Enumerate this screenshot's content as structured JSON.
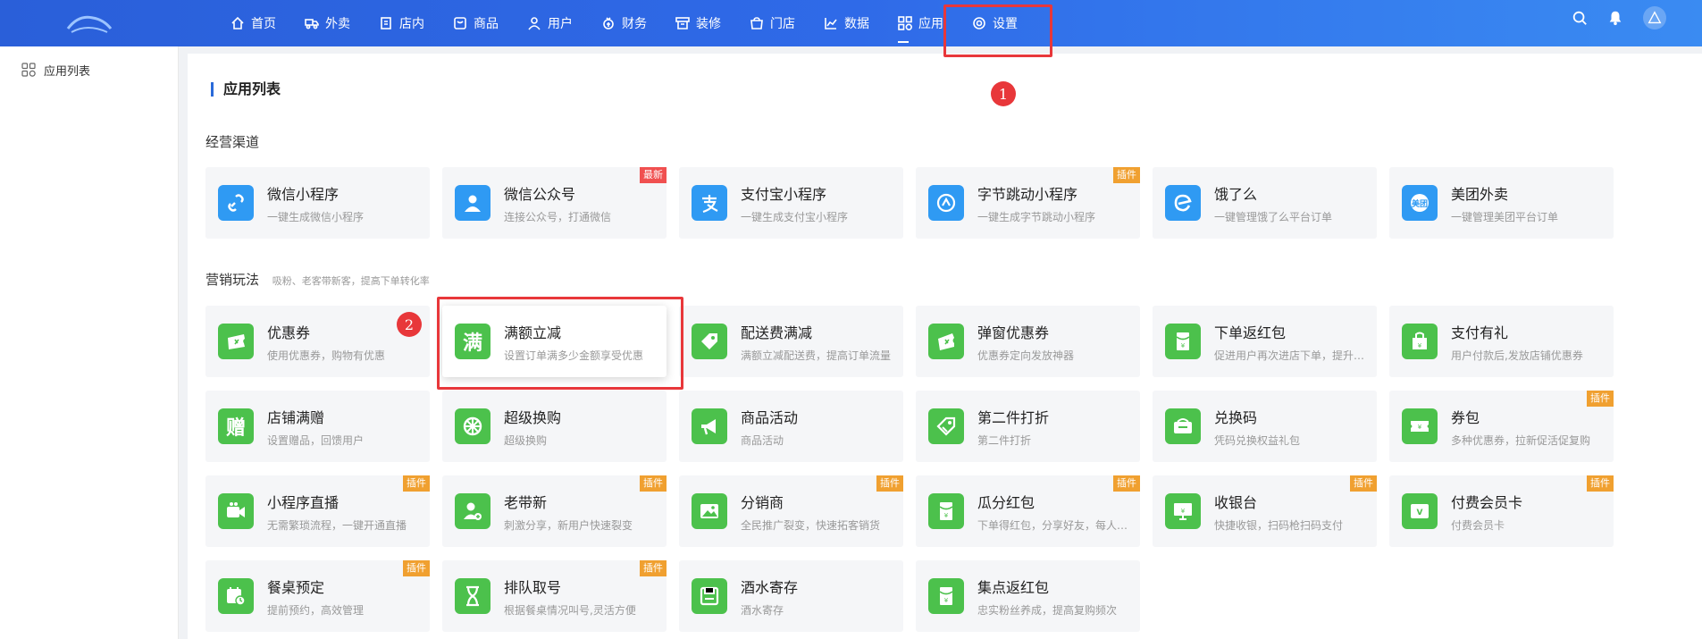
{
  "nav": {
    "items": [
      {
        "label": "首页",
        "icon": "home-icon"
      },
      {
        "label": "外卖",
        "icon": "delivery-icon"
      },
      {
        "label": "店内",
        "icon": "store-inside-icon"
      },
      {
        "label": "商品",
        "icon": "goods-icon"
      },
      {
        "label": "用户",
        "icon": "user-icon"
      },
      {
        "label": "财务",
        "icon": "finance-icon"
      },
      {
        "label": "装修",
        "icon": "decorate-icon"
      },
      {
        "label": "门店",
        "icon": "shop-icon"
      },
      {
        "label": "数据",
        "icon": "chart-icon"
      },
      {
        "label": "应用",
        "icon": "apps-icon"
      },
      {
        "label": "设置",
        "icon": "gear-icon"
      }
    ],
    "active": "应用"
  },
  "sidebar": {
    "items": [
      {
        "label": "应用列表",
        "icon": "apps-icon"
      }
    ]
  },
  "main": {
    "title": "应用列表",
    "sections": [
      {
        "title": "经营渠道",
        "subtitle": ""
      },
      {
        "title": "营销玩法",
        "subtitle": "吸粉、老客带新客，提高下单转化率"
      }
    ]
  },
  "channels": [
    {
      "name": "微信小程序",
      "desc": "一键生成微信小程序",
      "icon": "link-icon",
      "badge": ""
    },
    {
      "name": "微信公众号",
      "desc": "连接公众号，打通微信",
      "icon": "person-icon",
      "badge": "最新"
    },
    {
      "name": "支付宝小程序",
      "desc": "一键生成支付宝小程序",
      "icon": "alipay-icon",
      "badge": ""
    },
    {
      "name": "字节跳动小程序",
      "desc": "一键生成字节跳动小程序",
      "icon": "bytedance-icon",
      "badge": "插件"
    },
    {
      "name": "饿了么",
      "desc": "一键管理饿了么平台订单",
      "icon": "eleme-icon",
      "badge": ""
    },
    {
      "name": "美团外卖",
      "desc": "一键管理美团平台订单",
      "icon": "meituan-icon",
      "badge": ""
    }
  ],
  "marketing": [
    {
      "name": "优惠券",
      "desc": "使用优惠券，购物有优惠",
      "icon": "coupon-icon",
      "badge": ""
    },
    {
      "name": "满额立减",
      "desc": "设置订单满多少金额享受优惠",
      "icon": "full-reduce-icon",
      "glyph": "满",
      "badge": ""
    },
    {
      "name": "配送费满减",
      "desc": "满额立减配送费，提高订单流量",
      "icon": "tag-icon",
      "badge": ""
    },
    {
      "name": "弹窗优惠券",
      "desc": "优惠券定向发放神器",
      "icon": "popup-coupon-icon",
      "badge": ""
    },
    {
      "name": "下单返红包",
      "desc": "促进用户再次进店下单，提升复购",
      "icon": "red-packet-icon",
      "badge": ""
    },
    {
      "name": "支付有礼",
      "desc": "用户付款后,发放店铺优惠券",
      "icon": "gift-bag-icon",
      "badge": ""
    },
    {
      "name": "店铺满赠",
      "desc": "设置赠品，回馈用户",
      "icon": "gift-icon",
      "glyph": "赠",
      "badge": ""
    },
    {
      "name": "超级换购",
      "desc": "超级换购",
      "icon": "wheel-icon",
      "badge": ""
    },
    {
      "name": "商品活动",
      "desc": "商品活动",
      "icon": "megaphone-icon",
      "badge": ""
    },
    {
      "name": "第二件打折",
      "desc": "第二件打折",
      "icon": "discount-tag-icon",
      "badge": ""
    },
    {
      "name": "兑换码",
      "desc": "凭码兑换权益礼包",
      "icon": "exchange-code-icon",
      "badge": ""
    },
    {
      "name": "券包",
      "desc": "多种优惠券，拉新促活促复购",
      "icon": "ticket-icon",
      "badge": "插件"
    },
    {
      "name": "小程序直播",
      "desc": "无需繁琐流程，一键开通直播",
      "icon": "video-icon",
      "badge": "插件"
    },
    {
      "name": "老带新",
      "desc": "刺激分享，新用户快速裂变",
      "icon": "user-add-icon",
      "badge": "插件"
    },
    {
      "name": "分销商",
      "desc": "全民推广裂变，快速拓客销货",
      "icon": "image-icon",
      "badge": "插件"
    },
    {
      "name": "瓜分红包",
      "desc": "下单得红包，分享好友，每人都有",
      "icon": "split-packet-icon",
      "badge": "插件"
    },
    {
      "name": "收银台",
      "desc": "快捷收银，扫码枪扫码支付",
      "icon": "cashier-icon",
      "badge": "插件"
    },
    {
      "name": "付费会员卡",
      "desc": "付费会员卡",
      "icon": "vip-card-icon",
      "badge": "插件"
    },
    {
      "name": "餐桌预定",
      "desc": "提前预约，高效管理",
      "icon": "calendar-clock-icon",
      "badge": "插件"
    },
    {
      "name": "排队取号",
      "desc": "根据餐桌情况叫号,灵活方便",
      "icon": "hourglass-icon",
      "badge": "插件"
    },
    {
      "name": "酒水寄存",
      "desc": "酒水寄存",
      "icon": "storage-icon",
      "badge": ""
    },
    {
      "name": "集点返红包",
      "desc": "忠实粉丝养成，提高复购频次",
      "icon": "points-packet-icon",
      "badge": ""
    }
  ],
  "annotations": [
    {
      "label": "1"
    },
    {
      "label": "2"
    }
  ]
}
